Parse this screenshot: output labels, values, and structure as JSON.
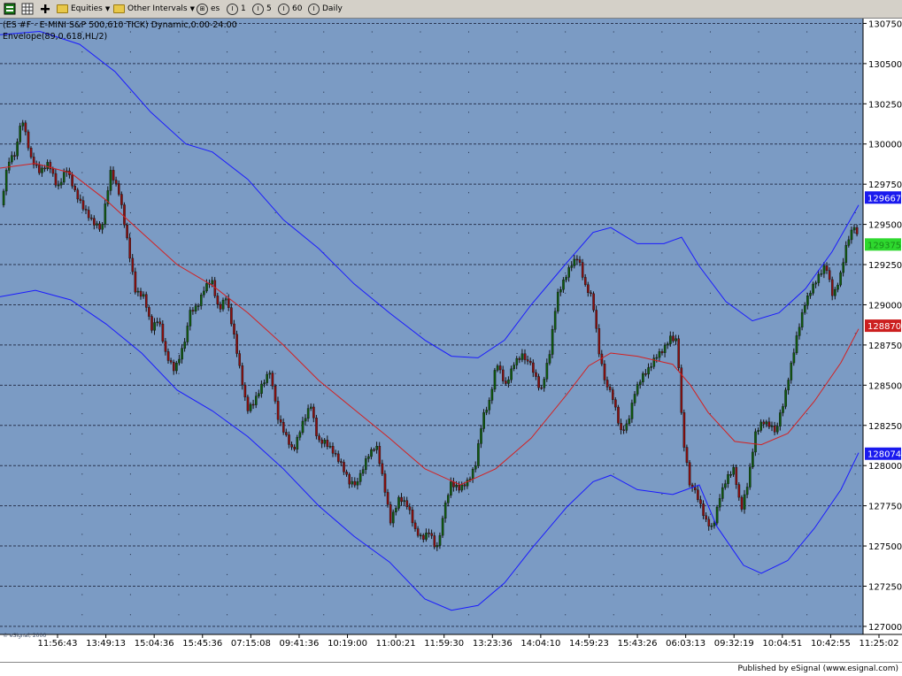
{
  "toolbar": {
    "equities_label": "Equities",
    "other_intervals_label": "Other Intervals",
    "symbol_label": "es",
    "interval_1_label": "1",
    "interval_5_label": "5",
    "interval_60_label": "60",
    "daily_label": "Daily"
  },
  "chart_title": "(ES #F - E-MINI S&P 500,610 TICK) Dynamic,0:00-24:00",
  "study_title": "Envelope(89,0.618,HL/2)",
  "watermark": "© eSignal, 2006",
  "published_by": "Published by eSignal (www.esignal.com)",
  "colors": {
    "background": "#7b9bc4",
    "candle_up": "#0f5a0f",
    "candle_down": "#8a0f0f",
    "wick": "#111111",
    "envelope_band": "#1a1aff",
    "moving_average": "#d42020",
    "last_price_tag": "#2ed82e",
    "upper_tag": "#1a1aee",
    "ma_tag": "#cc1f1f",
    "lower_tag": "#1a1aee"
  },
  "chart_data": {
    "type": "candlestick",
    "title": "(ES #F - E-MINI S&P 500,610 TICK) Dynamic,0:00-24:00",
    "study": "Envelope(89,0.618,HL/2)",
    "ylim": [
      126950,
      130780
    ],
    "y_ticks": [
      130750,
      130500,
      130250,
      130000,
      129750,
      129500,
      129250,
      129000,
      128750,
      128500,
      128250,
      128000,
      127750,
      127500,
      127250,
      127000
    ],
    "x_ticks": [
      "11:56:43",
      "13:49:13",
      "15:04:36",
      "15:45:36",
      "07:15:08",
      "09:41:36",
      "10:19:00",
      "11:00:21",
      "11:59:30",
      "13:23:36",
      "14:04:10",
      "14:59:23",
      "15:43:26",
      "06:03:13",
      "09:32:19",
      "10:04:51",
      "10:42:55",
      "11:25:02"
    ],
    "price_tags": {
      "upper_band": 129667,
      "last": 129375,
      "moving_average": 128870,
      "lower_band": 128074
    },
    "close_path": [
      [
        0,
        129620
      ],
      [
        8,
        129900
      ],
      [
        16,
        129950
      ],
      [
        24,
        130150
      ],
      [
        34,
        129900
      ],
      [
        44,
        129820
      ],
      [
        54,
        129880
      ],
      [
        64,
        129720
      ],
      [
        74,
        129850
      ],
      [
        84,
        129700
      ],
      [
        94,
        129600
      ],
      [
        104,
        129520
      ],
      [
        114,
        129480
      ],
      [
        124,
        129820
      ],
      [
        134,
        129680
      ],
      [
        144,
        129350
      ],
      [
        152,
        129080
      ],
      [
        162,
        129050
      ],
      [
        170,
        128850
      ],
      [
        178,
        128920
      ],
      [
        186,
        128700
      ],
      [
        196,
        128600
      ],
      [
        206,
        128750
      ],
      [
        214,
        128950
      ],
      [
        222,
        128980
      ],
      [
        230,
        129100
      ],
      [
        238,
        129150
      ],
      [
        246,
        128960
      ],
      [
        254,
        129050
      ],
      [
        262,
        128850
      ],
      [
        270,
        128600
      ],
      [
        278,
        128350
      ],
      [
        286,
        128400
      ],
      [
        294,
        128500
      ],
      [
        304,
        128600
      ],
      [
        312,
        128300
      ],
      [
        320,
        128200
      ],
      [
        330,
        128080
      ],
      [
        340,
        128250
      ],
      [
        350,
        128380
      ],
      [
        358,
        128150
      ],
      [
        366,
        128150
      ],
      [
        374,
        128100
      ],
      [
        384,
        128020
      ],
      [
        394,
        127900
      ],
      [
        404,
        127900
      ],
      [
        414,
        128050
      ],
      [
        424,
        128120
      ],
      [
        432,
        127900
      ],
      [
        440,
        127650
      ],
      [
        450,
        127800
      ],
      [
        460,
        127750
      ],
      [
        468,
        127600
      ],
      [
        476,
        127550
      ],
      [
        484,
        127600
      ],
      [
        492,
        127480
      ],
      [
        500,
        127700
      ],
      [
        508,
        127880
      ],
      [
        518,
        127850
      ],
      [
        528,
        127900
      ],
      [
        536,
        128000
      ],
      [
        544,
        128300
      ],
      [
        552,
        128400
      ],
      [
        560,
        128650
      ],
      [
        570,
        128500
      ],
      [
        580,
        128650
      ],
      [
        590,
        128700
      ],
      [
        600,
        128600
      ],
      [
        610,
        128450
      ],
      [
        620,
        128700
      ],
      [
        628,
        129050
      ],
      [
        636,
        129150
      ],
      [
        644,
        129250
      ],
      [
        652,
        129300
      ],
      [
        660,
        129120
      ],
      [
        668,
        129050
      ],
      [
        676,
        128700
      ],
      [
        684,
        128500
      ],
      [
        692,
        128400
      ],
      [
        700,
        128200
      ],
      [
        708,
        128250
      ],
      [
        716,
        128450
      ],
      [
        724,
        128550
      ],
      [
        732,
        128600
      ],
      [
        740,
        128680
      ],
      [
        748,
        128720
      ],
      [
        756,
        128800
      ],
      [
        764,
        128780
      ],
      [
        770,
        128200
      ],
      [
        778,
        127900
      ],
      [
        788,
        127780
      ],
      [
        796,
        127650
      ],
      [
        804,
        127600
      ],
      [
        812,
        127800
      ],
      [
        820,
        127920
      ],
      [
        828,
        127980
      ],
      [
        836,
        127720
      ],
      [
        844,
        127900
      ],
      [
        852,
        128200
      ],
      [
        860,
        128280
      ],
      [
        868,
        128260
      ],
      [
        876,
        128220
      ],
      [
        884,
        128380
      ],
      [
        892,
        128600
      ],
      [
        900,
        128820
      ],
      [
        908,
        129000
      ],
      [
        916,
        129100
      ],
      [
        924,
        129180
      ],
      [
        932,
        129250
      ],
      [
        940,
        129050
      ],
      [
        948,
        129180
      ],
      [
        956,
        129400
      ],
      [
        964,
        129500
      ],
      [
        970,
        129380
      ]
    ],
    "moving_average_path": [
      [
        0,
        129850
      ],
      [
        40,
        129880
      ],
      [
        80,
        129820
      ],
      [
        120,
        129650
      ],
      [
        160,
        129450
      ],
      [
        200,
        129250
      ],
      [
        240,
        129120
      ],
      [
        280,
        128950
      ],
      [
        320,
        128750
      ],
      [
        360,
        128530
      ],
      [
        400,
        128350
      ],
      [
        440,
        128170
      ],
      [
        480,
        127980
      ],
      [
        520,
        127880
      ],
      [
        560,
        127980
      ],
      [
        600,
        128170
      ],
      [
        640,
        128440
      ],
      [
        665,
        128620
      ],
      [
        690,
        128700
      ],
      [
        720,
        128680
      ],
      [
        760,
        128630
      ],
      [
        780,
        128500
      ],
      [
        800,
        128330
      ],
      [
        830,
        128150
      ],
      [
        860,
        128130
      ],
      [
        890,
        128200
      ],
      [
        920,
        128400
      ],
      [
        950,
        128640
      ],
      [
        970,
        128850
      ]
    ],
    "upper_band_path": [
      [
        0,
        130680
      ],
      [
        45,
        130700
      ],
      [
        90,
        130620
      ],
      [
        130,
        130450
      ],
      [
        170,
        130200
      ],
      [
        210,
        130000
      ],
      [
        240,
        129950
      ],
      [
        280,
        129780
      ],
      [
        320,
        129530
      ],
      [
        360,
        129350
      ],
      [
        400,
        129130
      ],
      [
        440,
        128950
      ],
      [
        480,
        128780
      ],
      [
        510,
        128680
      ],
      [
        540,
        128670
      ],
      [
        570,
        128780
      ],
      [
        600,
        129000
      ],
      [
        640,
        129260
      ],
      [
        670,
        129450
      ],
      [
        690,
        129480
      ],
      [
        720,
        129380
      ],
      [
        750,
        129380
      ],
      [
        770,
        129420
      ],
      [
        790,
        129240
      ],
      [
        820,
        129020
      ],
      [
        850,
        128900
      ],
      [
        880,
        128950
      ],
      [
        910,
        129100
      ],
      [
        940,
        129330
      ],
      [
        970,
        129620
      ]
    ],
    "lower_band_path": [
      [
        0,
        129050
      ],
      [
        40,
        129090
      ],
      [
        80,
        129030
      ],
      [
        120,
        128880
      ],
      [
        160,
        128700
      ],
      [
        200,
        128470
      ],
      [
        240,
        128340
      ],
      [
        280,
        128180
      ],
      [
        320,
        127980
      ],
      [
        360,
        127750
      ],
      [
        400,
        127560
      ],
      [
        440,
        127400
      ],
      [
        480,
        127170
      ],
      [
        510,
        127100
      ],
      [
        540,
        127130
      ],
      [
        570,
        127270
      ],
      [
        600,
        127480
      ],
      [
        640,
        127740
      ],
      [
        670,
        127900
      ],
      [
        690,
        127940
      ],
      [
        720,
        127850
      ],
      [
        760,
        127820
      ],
      [
        790,
        127880
      ],
      [
        810,
        127620
      ],
      [
        840,
        127380
      ],
      [
        860,
        127330
      ],
      [
        890,
        127410
      ],
      [
        920,
        127610
      ],
      [
        950,
        127850
      ],
      [
        970,
        128080
      ]
    ]
  }
}
